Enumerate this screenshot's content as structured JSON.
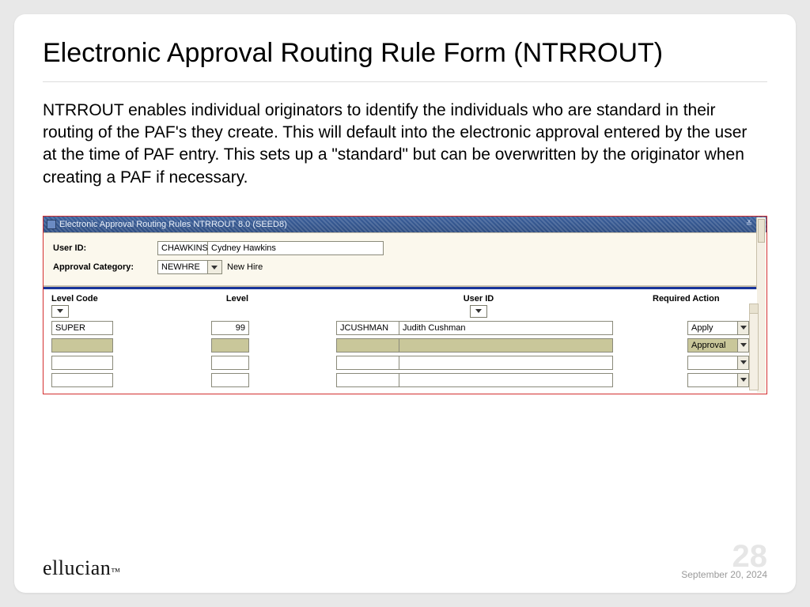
{
  "slide": {
    "title": "Electronic Approval Routing Rule Form (NTRROUT)",
    "body": "NTRROUT enables individual originators to identify the individuals who are standard in their routing of the PAF's they create.  This will default into the electronic approval entered by the user at the time of PAF entry.  This sets up a \"standard\" but can be overwritten by the originator when creating a PAF if necessary."
  },
  "app": {
    "window_title": "Electronic Approval Routing Rules  NTRROUT  8.0  (SEED8)",
    "labels": {
      "user_id": "User ID:",
      "approval_category": "Approval Category:"
    },
    "user": {
      "id": "CHAWKINS",
      "name": "Cydney Hawkins"
    },
    "category": {
      "code": "NEWHRE",
      "name": "New Hire"
    },
    "columns": {
      "level_code": "Level Code",
      "level": "Level",
      "user_id": "User ID",
      "required_action": "Required Action"
    },
    "rows": [
      {
        "level_code": "SUPER",
        "level": "99",
        "user_id": "JCUSHMAN",
        "user_name": "Judith Cushman",
        "action": "Apply",
        "highlight": false
      },
      {
        "level_code": "",
        "level": "",
        "user_id": "",
        "user_name": "",
        "action": "Approval",
        "highlight": true
      },
      {
        "level_code": "",
        "level": "",
        "user_id": "",
        "user_name": "",
        "action": "",
        "highlight": false
      },
      {
        "level_code": "",
        "level": "",
        "user_id": "",
        "user_name": "",
        "action": "",
        "highlight": false
      }
    ]
  },
  "footer": {
    "brand": "ellucian",
    "page": "28",
    "date": "September 20, 2024"
  }
}
